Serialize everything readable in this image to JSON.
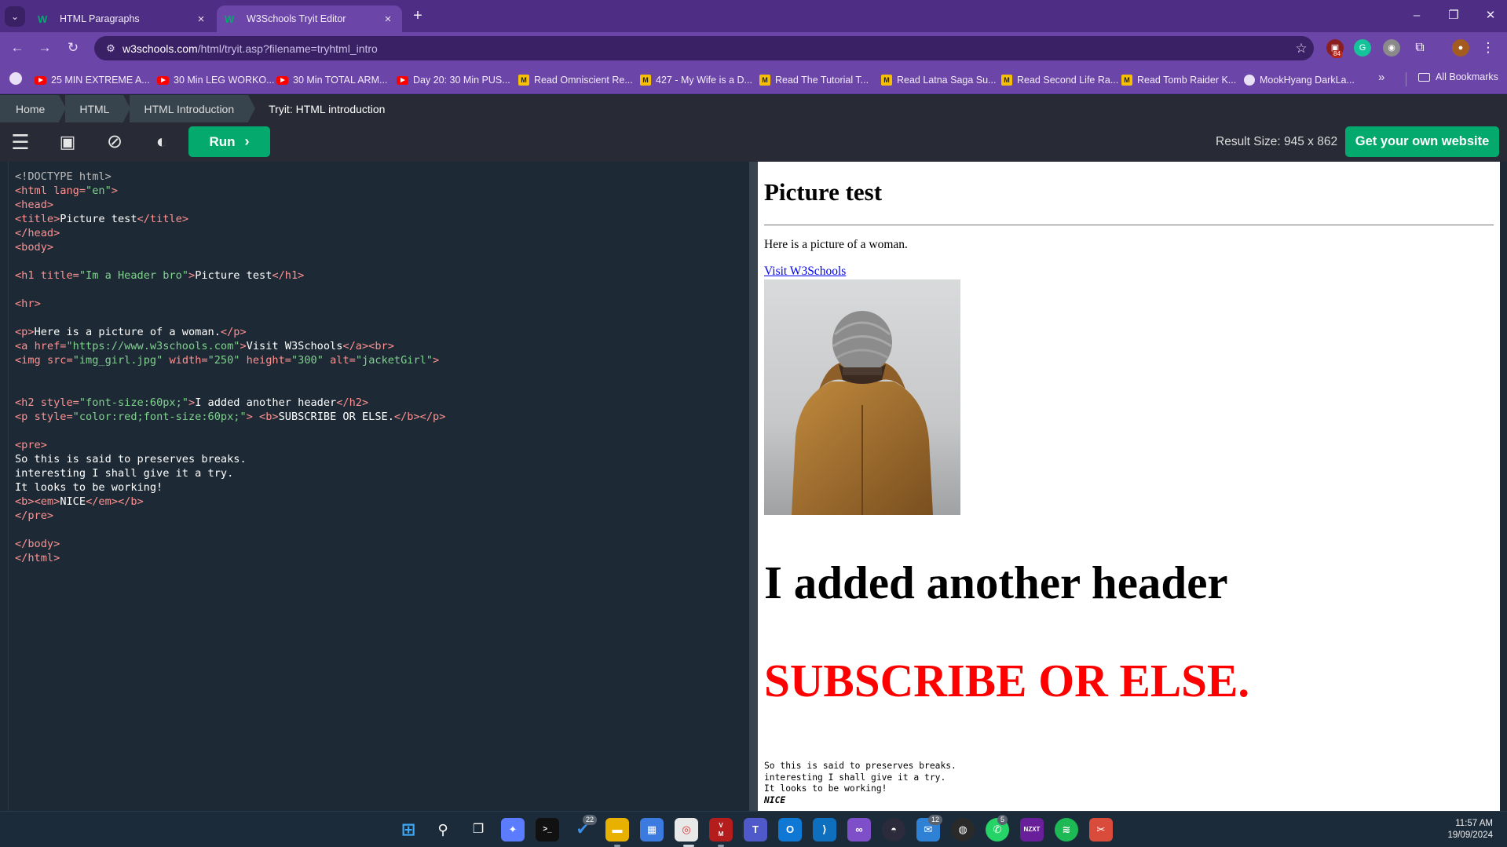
{
  "browser": {
    "tabs": [
      {
        "title": "HTML Paragraphs",
        "active": false
      },
      {
        "title": "W3Schools Tryit Editor",
        "active": true
      }
    ],
    "url_host": "w3schools.com",
    "url_path": "/html/tryit.asp?filename=tryhtml_intro",
    "ext_badge": "84",
    "bookmarks": [
      {
        "label": "25 MIN EXTREME A...",
        "icon": "youtube-icon"
      },
      {
        "label": "30 Min LEG WORKO...",
        "icon": "youtube-icon"
      },
      {
        "label": "30 Min TOTAL ARM...",
        "icon": "youtube-icon"
      },
      {
        "label": "Day 20: 30 Min PUS...",
        "icon": "youtube-icon"
      },
      {
        "label": "Read Omniscient Re...",
        "icon": "manga-icon"
      },
      {
        "label": "427 - My Wife is a D...",
        "icon": "manga-icon"
      },
      {
        "label": "Read The Tutorial T...",
        "icon": "manga-icon"
      },
      {
        "label": "Read Latna Saga Su...",
        "icon": "manga-icon"
      },
      {
        "label": "Read Second Life Ra...",
        "icon": "manga-icon"
      },
      {
        "label": "Read Tomb Raider K...",
        "icon": "manga-icon"
      },
      {
        "label": "MookHyang DarkLa...",
        "icon": "site-icon"
      }
    ],
    "all_bookmarks": "All Bookmarks",
    "more": "»"
  },
  "breadcrumb": [
    "Home",
    "HTML",
    "HTML Introduction",
    "Tryit: HTML introduction"
  ],
  "editor": {
    "run_label": "Run",
    "result_size": "Result Size: 945 x 862",
    "own_website": "Get your own website"
  },
  "code_lines": [
    "<!DOCTYPE html>",
    "<html lang=\"en\">",
    "<head>",
    "<title>Picture test</title>",
    "</head>",
    "<body>",
    "",
    "<h1 title=\"Im a Header bro\">Picture test</h1>",
    "",
    "<hr>",
    "",
    "<p>Here is a picture of a woman.</p>",
    "<a href=\"https://www.w3schools.com\">Visit W3Schools</a><br>",
    "<img src=\"img_girl.jpg\" width=\"250\" height=\"300\" alt=\"jacketGirl\">",
    "",
    "",
    "<h2 style=\"font-size:60px;\">I added another header</h2>",
    "<p style=\"color:red;font-size:60px;\"> <b>SUBSCRIBE OR ELSE.</b></p>",
    "",
    "<pre>",
    "So this is said to preserves breaks.",
    "interesting I shall give it a try.",
    "It looks to be working!",
    "<b><em>NICE</em></b>",
    "</pre>",
    "",
    "</body>",
    "</html>"
  ],
  "result": {
    "h1": "Picture test",
    "paragraph": "Here is a picture of a woman.",
    "link": "Visit W3Schools",
    "h2": "I added another header",
    "subscribe": "SUBSCRIBE OR ELSE.",
    "pre_lines": [
      "So this is said to preserves breaks.",
      "interesting I shall give it a try.",
      "It looks to be working!"
    ],
    "pre_bold": "NICE"
  },
  "taskbar": {
    "badges": {
      "todo": "22",
      "mail": "12",
      "whatsapp": "5"
    },
    "time": "11:57 AM",
    "date": "19/09/2024"
  }
}
